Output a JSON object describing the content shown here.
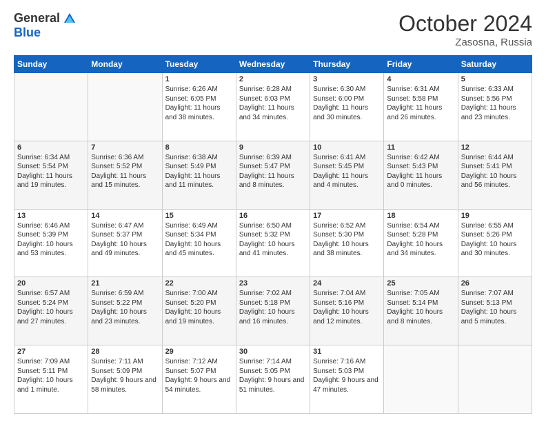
{
  "header": {
    "logo_general": "General",
    "logo_blue": "Blue",
    "month_title": "October 2024",
    "location": "Zasosna, Russia"
  },
  "weekdays": [
    "Sunday",
    "Monday",
    "Tuesday",
    "Wednesday",
    "Thursday",
    "Friday",
    "Saturday"
  ],
  "rows": [
    [
      {
        "day": "",
        "sunrise": "",
        "sunset": "",
        "daylight": ""
      },
      {
        "day": "",
        "sunrise": "",
        "sunset": "",
        "daylight": ""
      },
      {
        "day": "1",
        "sunrise": "Sunrise: 6:26 AM",
        "sunset": "Sunset: 6:05 PM",
        "daylight": "Daylight: 11 hours and 38 minutes."
      },
      {
        "day": "2",
        "sunrise": "Sunrise: 6:28 AM",
        "sunset": "Sunset: 6:03 PM",
        "daylight": "Daylight: 11 hours and 34 minutes."
      },
      {
        "day": "3",
        "sunrise": "Sunrise: 6:30 AM",
        "sunset": "Sunset: 6:00 PM",
        "daylight": "Daylight: 11 hours and 30 minutes."
      },
      {
        "day": "4",
        "sunrise": "Sunrise: 6:31 AM",
        "sunset": "Sunset: 5:58 PM",
        "daylight": "Daylight: 11 hours and 26 minutes."
      },
      {
        "day": "5",
        "sunrise": "Sunrise: 6:33 AM",
        "sunset": "Sunset: 5:56 PM",
        "daylight": "Daylight: 11 hours and 23 minutes."
      }
    ],
    [
      {
        "day": "6",
        "sunrise": "Sunrise: 6:34 AM",
        "sunset": "Sunset: 5:54 PM",
        "daylight": "Daylight: 11 hours and 19 minutes."
      },
      {
        "day": "7",
        "sunrise": "Sunrise: 6:36 AM",
        "sunset": "Sunset: 5:52 PM",
        "daylight": "Daylight: 11 hours and 15 minutes."
      },
      {
        "day": "8",
        "sunrise": "Sunrise: 6:38 AM",
        "sunset": "Sunset: 5:49 PM",
        "daylight": "Daylight: 11 hours and 11 minutes."
      },
      {
        "day": "9",
        "sunrise": "Sunrise: 6:39 AM",
        "sunset": "Sunset: 5:47 PM",
        "daylight": "Daylight: 11 hours and 8 minutes."
      },
      {
        "day": "10",
        "sunrise": "Sunrise: 6:41 AM",
        "sunset": "Sunset: 5:45 PM",
        "daylight": "Daylight: 11 hours and 4 minutes."
      },
      {
        "day": "11",
        "sunrise": "Sunrise: 6:42 AM",
        "sunset": "Sunset: 5:43 PM",
        "daylight": "Daylight: 11 hours and 0 minutes."
      },
      {
        "day": "12",
        "sunrise": "Sunrise: 6:44 AM",
        "sunset": "Sunset: 5:41 PM",
        "daylight": "Daylight: 10 hours and 56 minutes."
      }
    ],
    [
      {
        "day": "13",
        "sunrise": "Sunrise: 6:46 AM",
        "sunset": "Sunset: 5:39 PM",
        "daylight": "Daylight: 10 hours and 53 minutes."
      },
      {
        "day": "14",
        "sunrise": "Sunrise: 6:47 AM",
        "sunset": "Sunset: 5:37 PM",
        "daylight": "Daylight: 10 hours and 49 minutes."
      },
      {
        "day": "15",
        "sunrise": "Sunrise: 6:49 AM",
        "sunset": "Sunset: 5:34 PM",
        "daylight": "Daylight: 10 hours and 45 minutes."
      },
      {
        "day": "16",
        "sunrise": "Sunrise: 6:50 AM",
        "sunset": "Sunset: 5:32 PM",
        "daylight": "Daylight: 10 hours and 41 minutes."
      },
      {
        "day": "17",
        "sunrise": "Sunrise: 6:52 AM",
        "sunset": "Sunset: 5:30 PM",
        "daylight": "Daylight: 10 hours and 38 minutes."
      },
      {
        "day": "18",
        "sunrise": "Sunrise: 6:54 AM",
        "sunset": "Sunset: 5:28 PM",
        "daylight": "Daylight: 10 hours and 34 minutes."
      },
      {
        "day": "19",
        "sunrise": "Sunrise: 6:55 AM",
        "sunset": "Sunset: 5:26 PM",
        "daylight": "Daylight: 10 hours and 30 minutes."
      }
    ],
    [
      {
        "day": "20",
        "sunrise": "Sunrise: 6:57 AM",
        "sunset": "Sunset: 5:24 PM",
        "daylight": "Daylight: 10 hours and 27 minutes."
      },
      {
        "day": "21",
        "sunrise": "Sunrise: 6:59 AM",
        "sunset": "Sunset: 5:22 PM",
        "daylight": "Daylight: 10 hours and 23 minutes."
      },
      {
        "day": "22",
        "sunrise": "Sunrise: 7:00 AM",
        "sunset": "Sunset: 5:20 PM",
        "daylight": "Daylight: 10 hours and 19 minutes."
      },
      {
        "day": "23",
        "sunrise": "Sunrise: 7:02 AM",
        "sunset": "Sunset: 5:18 PM",
        "daylight": "Daylight: 10 hours and 16 minutes."
      },
      {
        "day": "24",
        "sunrise": "Sunrise: 7:04 AM",
        "sunset": "Sunset: 5:16 PM",
        "daylight": "Daylight: 10 hours and 12 minutes."
      },
      {
        "day": "25",
        "sunrise": "Sunrise: 7:05 AM",
        "sunset": "Sunset: 5:14 PM",
        "daylight": "Daylight: 10 hours and 8 minutes."
      },
      {
        "day": "26",
        "sunrise": "Sunrise: 7:07 AM",
        "sunset": "Sunset: 5:13 PM",
        "daylight": "Daylight: 10 hours and 5 minutes."
      }
    ],
    [
      {
        "day": "27",
        "sunrise": "Sunrise: 7:09 AM",
        "sunset": "Sunset: 5:11 PM",
        "daylight": "Daylight: 10 hours and 1 minute."
      },
      {
        "day": "28",
        "sunrise": "Sunrise: 7:11 AM",
        "sunset": "Sunset: 5:09 PM",
        "daylight": "Daylight: 9 hours and 58 minutes."
      },
      {
        "day": "29",
        "sunrise": "Sunrise: 7:12 AM",
        "sunset": "Sunset: 5:07 PM",
        "daylight": "Daylight: 9 hours and 54 minutes."
      },
      {
        "day": "30",
        "sunrise": "Sunrise: 7:14 AM",
        "sunset": "Sunset: 5:05 PM",
        "daylight": "Daylight: 9 hours and 51 minutes."
      },
      {
        "day": "31",
        "sunrise": "Sunrise: 7:16 AM",
        "sunset": "Sunset: 5:03 PM",
        "daylight": "Daylight: 9 hours and 47 minutes."
      },
      {
        "day": "",
        "sunrise": "",
        "sunset": "",
        "daylight": ""
      },
      {
        "day": "",
        "sunrise": "",
        "sunset": "",
        "daylight": ""
      }
    ]
  ]
}
